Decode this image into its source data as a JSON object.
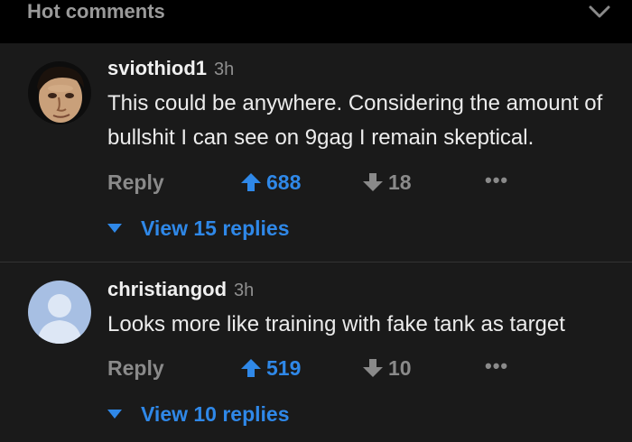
{
  "header": {
    "title": "Hot comments"
  },
  "comments": [
    {
      "username": "sviothiod1",
      "time": "3h",
      "text": "This could be anywhere. Considering the amount of bullshit I can see on 9gag I remain skeptical.",
      "reply_label": "Reply",
      "upvotes": "688",
      "downvotes": "18",
      "more_label": "•••",
      "view_replies": "View 15 replies"
    },
    {
      "username": "christiangod",
      "time": "3h",
      "text": "Looks more like training with fake tank as target",
      "reply_label": "Reply",
      "upvotes": "519",
      "downvotes": "10",
      "more_label": "•••",
      "view_replies": "View 10 replies"
    }
  ],
  "colors": {
    "accent": "#2f88e8",
    "background": "#1a1a1a",
    "header_bg": "#000000",
    "muted": "#8a8a8a"
  },
  "icons": {
    "header_toggle": "chevron-down-icon",
    "upvote": "arrow-up-icon",
    "downvote": "arrow-down-icon",
    "more": "ellipsis-icon",
    "expand_replies": "triangle-down-icon"
  }
}
